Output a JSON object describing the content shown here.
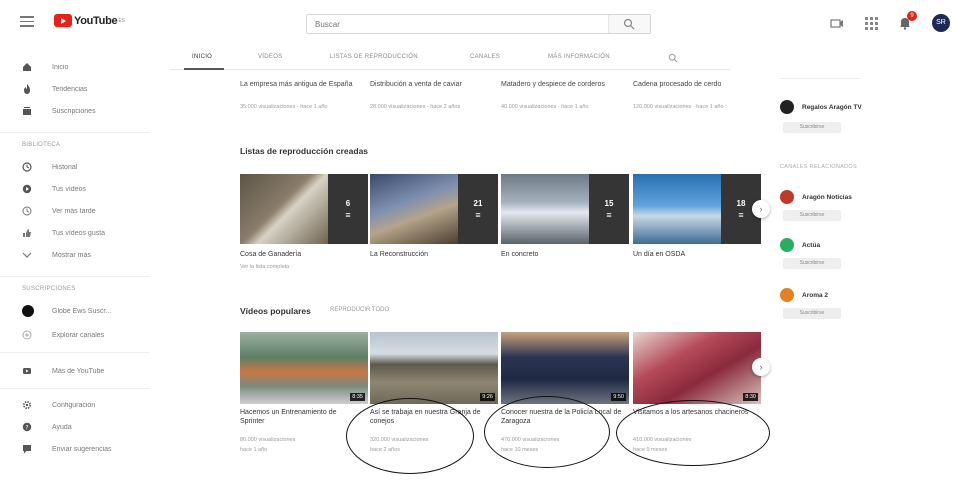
{
  "header": {
    "logo_text": "YouTube",
    "logo_superscript": "ES",
    "search_placeholder": "Buscar",
    "notification_count": "9",
    "avatar_initials": "SR"
  },
  "sidebar": {
    "items_top": [
      {
        "label": "Inicio",
        "icon": "home-icon"
      },
      {
        "label": "Tendencias",
        "icon": "fire-icon"
      },
      {
        "label": "Suscripciones",
        "icon": "subscriptions-icon"
      }
    ],
    "library_heading": "Biblioteca",
    "items_library": [
      {
        "label": "Historial",
        "icon": "history-icon"
      },
      {
        "label": "Tus vídeos",
        "icon": "my-videos-icon"
      },
      {
        "label": "Ver más tarde",
        "icon": "watch-later-icon"
      },
      {
        "label": "Tus vídeos gusta",
        "icon": "liked-icon"
      },
      {
        "label": "Mostrar más",
        "icon": "chevron-down-icon"
      }
    ],
    "subs_heading": "Suscripciones",
    "sub_channel": "Globe Ews Suscr...",
    "explore_channels": "Explorar canales",
    "more_from": "Más de YouTube",
    "items_bottom": [
      {
        "label": "Configuración",
        "icon": "gear-icon"
      },
      {
        "label": "Ayuda",
        "icon": "help-icon"
      },
      {
        "label": "Enviar sugerencias",
        "icon": "feedback-icon"
      }
    ]
  },
  "tabs": [
    {
      "label": "Inicio",
      "active": true
    },
    {
      "label": "Vídeos",
      "active": false
    },
    {
      "label": "Listas de reproducción",
      "active": false
    },
    {
      "label": "Canales",
      "active": false
    },
    {
      "label": "Más información",
      "active": false
    }
  ],
  "prev_row": [
    {
      "title": "La empresa más antigua de España",
      "meta": "35.000 visualizaciones · hace 1 año"
    },
    {
      "title": "Distribución a venta de caviar",
      "meta": "28.000 visualizaciones · hace 2 años"
    },
    {
      "title": "Matadero y despiece de corderos",
      "meta": "40.000 visualizaciones · hace 1 año"
    },
    {
      "title": "Cadena procesado de cerdo",
      "meta": "120.000 visualizaciones · hace 1 año"
    }
  ],
  "playlists": {
    "heading": "Listas de reproducción creadas",
    "items": [
      {
        "title": "Cosa de Ganadería",
        "link": "Ver la lista completa",
        "count": "6"
      },
      {
        "title": "La Reconstrucción",
        "link": "",
        "count": "21"
      },
      {
        "title": "En concreto",
        "link": "",
        "count": "15"
      },
      {
        "title": "Un día en OSDA",
        "link": "",
        "count": "18"
      }
    ]
  },
  "popular": {
    "heading": "Vídeos populares",
    "play_all": "Reproducir todo",
    "items": [
      {
        "title": "Hacemos un Entrenamiento de Sprinter",
        "meta1": "80.000 visualizaciones",
        "meta2": "hace 1 año",
        "duration": "8:35"
      },
      {
        "title": "Así se trabaja en nuestra Granja de conejos",
        "meta1": "320.000 visualizaciones",
        "meta2": "hace 2 años",
        "duration": "9:26"
      },
      {
        "title": "Conocer nuestra de la Policía Local de Zaragoza",
        "meta1": "470.000 visualizaciones",
        "meta2": "hace 10 meses",
        "duration": "9:50"
      },
      {
        "title": "Visitamos a los artesanos chacineros",
        "meta1": "410.000 visualizaciones",
        "meta2": "hace 9 meses",
        "duration": "8:30"
      }
    ]
  },
  "right_column": {
    "featured_channel": "Regalos Aragón TV",
    "related_heading": "Canales relacionados",
    "channels": [
      {
        "name": "Aragón Noticias",
        "color": "#c0392b"
      },
      {
        "name": "Actúa",
        "color": "#27ae60"
      },
      {
        "name": "Aroma 2",
        "color": "#e67e22"
      }
    ],
    "subscribe_label": "Suscribirse"
  }
}
